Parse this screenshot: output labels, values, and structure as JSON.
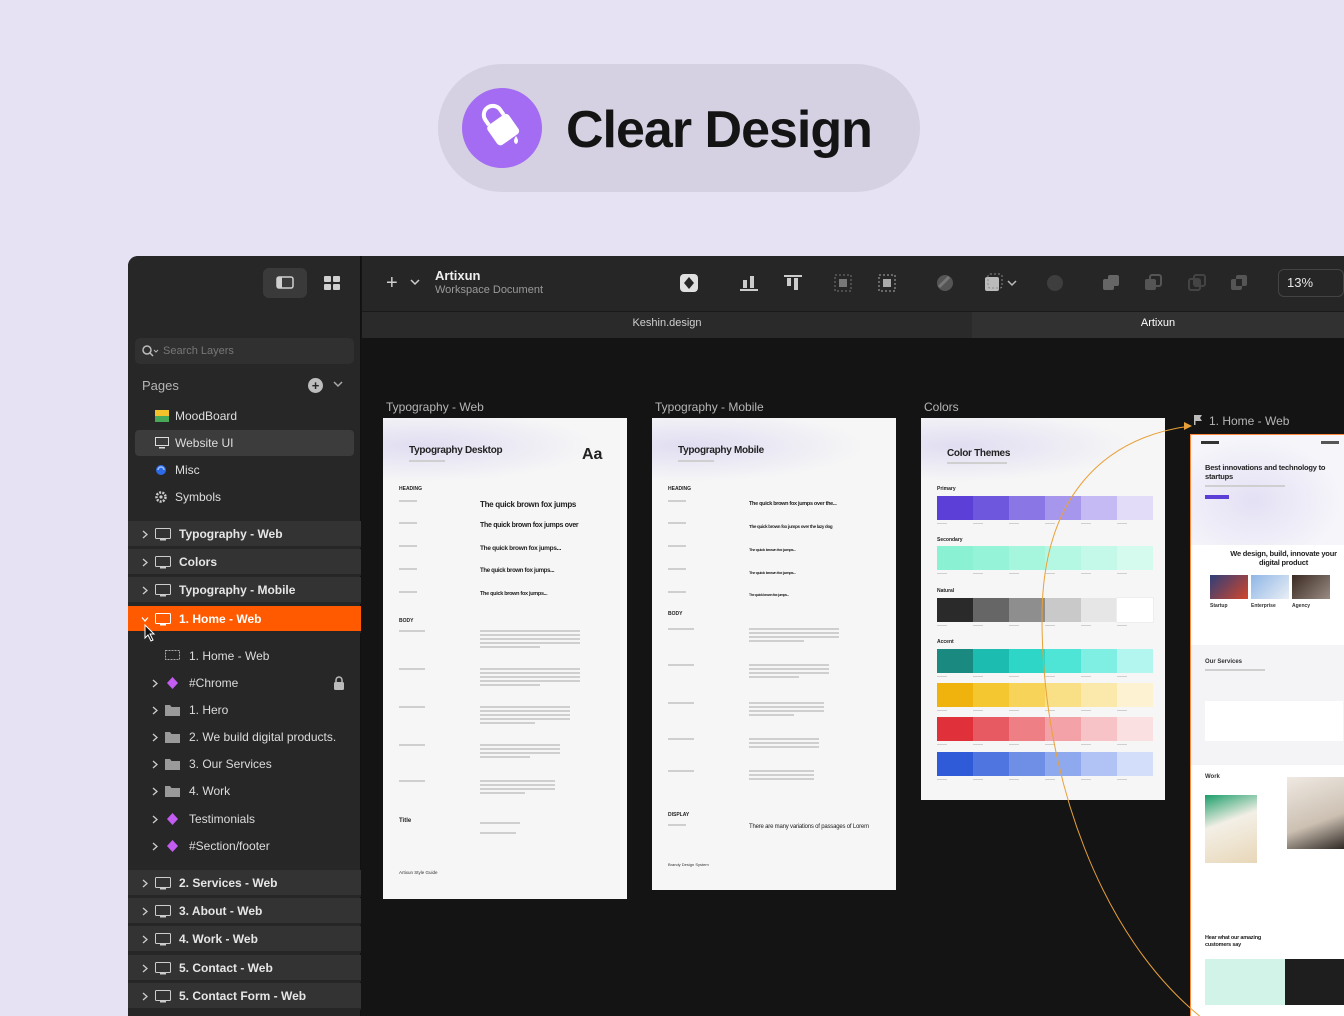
{
  "hero": {
    "title": "Clear Design",
    "icon": "paint-bucket-icon"
  },
  "sidebar": {
    "search_placeholder": "Search Layers",
    "pages_label": "Pages",
    "pages": [
      {
        "label": "MoodBoard",
        "icon": "image-icon"
      },
      {
        "label": "Website UI",
        "icon": "monitor-icon",
        "selected": true
      },
      {
        "label": "Misc",
        "icon": "swirl-icon"
      },
      {
        "label": "Symbols",
        "icon": "gear-icon"
      }
    ],
    "layers_top": [
      "Typography -  Web",
      "Colors",
      "Typography - Mobile",
      "1. Home - Web"
    ],
    "children": [
      "1. Home - Web",
      "#Chrome",
      "1. Hero",
      "2. We build digital products.",
      "3. Our Services",
      "4. Work",
      "Testimonials",
      "#Section/footer"
    ],
    "layers_bottom": [
      "2. Services - Web",
      "3. About - Web",
      "4. Work - Web",
      "5. Contact - Web",
      "5. Contact Form - Web"
    ]
  },
  "topbar": {
    "document_title": "Artixun",
    "document_subtitle": "Workspace Document",
    "zoom": "13%"
  },
  "tabs": [
    "Keshin.design",
    "Artixun"
  ],
  "canvas": {
    "artboard_labels": [
      "Typography -  Web",
      "Typography - Mobile",
      "Colors",
      "1. Home - Web"
    ],
    "typo_web": {
      "title": "Typography Desktop",
      "aa": "Aa",
      "heading": "HEADING",
      "samples": [
        "The quick brown fox jumps",
        "The quick brown fox jumps over",
        "The quick brown fox jumps...",
        "The quick brown fox jumps...",
        "The quick brown fox jumps..."
      ],
      "body": "BODY",
      "title_label": "Title",
      "footer": "Artixun Style Guide"
    },
    "typo_mobile": {
      "title": "Typography Mobile",
      "heading": "HEADING",
      "samples": [
        "The quick brown fox jumps over the...",
        "The quick brown fox jumps over the lazy dog",
        "The quick brown fox jumps...",
        "The quick brown fox jumps...",
        "The quick brown fox jumps..."
      ],
      "body": "BODY",
      "display": "DISPLAY",
      "display_text": "There are many variations of passages of Lorem",
      "footer": "Brandy Design System"
    },
    "colors": {
      "title": "Color Themes",
      "groups": [
        {
          "name": "Primary",
          "swatches": [
            "#5b3fd6",
            "#6e57dd",
            "#8a76e4",
            "#a797ec",
            "#c5baf3",
            "#e3dcf9"
          ]
        },
        {
          "name": "Secondary",
          "swatches": [
            "#8af2d2",
            "#95f4d7",
            "#a5f6dd",
            "#b4f8e3",
            "#c4f9e9",
            "#d5fbef"
          ]
        },
        {
          "name": "Natural",
          "swatches": [
            "#2a2a2a",
            "#666666",
            "#8e8e8e",
            "#c9c9c9",
            "#e6e6e6",
            "#ffffff"
          ]
        },
        {
          "name": "Accent",
          "swatches": [
            "#1a8a80",
            "#1cbdb0",
            "#2dd6c6",
            "#4fe5d6",
            "#7fefe3",
            "#b3f6ef"
          ]
        },
        {
          "name": "",
          "swatches": [
            "#f0b20c",
            "#f4c62f",
            "#f7d35a",
            "#f9df86",
            "#fbe9ab",
            "#fdf3d3"
          ]
        },
        {
          "name": "",
          "swatches": [
            "#e0303a",
            "#e85a61",
            "#ee7f84",
            "#f3a3a7",
            "#f7c3c6",
            "#fbe0e2"
          ]
        },
        {
          "name": "",
          "swatches": [
            "#2f5bd9",
            "#4f75e0",
            "#6f8fe7",
            "#8fa9ee",
            "#b0c3f4",
            "#d2defa"
          ]
        }
      ]
    },
    "home": {
      "hero_heading": "Best innovations and technology to startups",
      "build_heading": "We design, build, innovate your digital product",
      "cards": [
        "Startup",
        "Enterprise",
        "Agency"
      ],
      "services": "Our Services",
      "work": "Work",
      "testimonials": "Hear what our amazing customers say"
    }
  },
  "colors": {
    "accent": "#ff5a00",
    "purple": "#a36cf2",
    "flow": "#e8a13a"
  }
}
